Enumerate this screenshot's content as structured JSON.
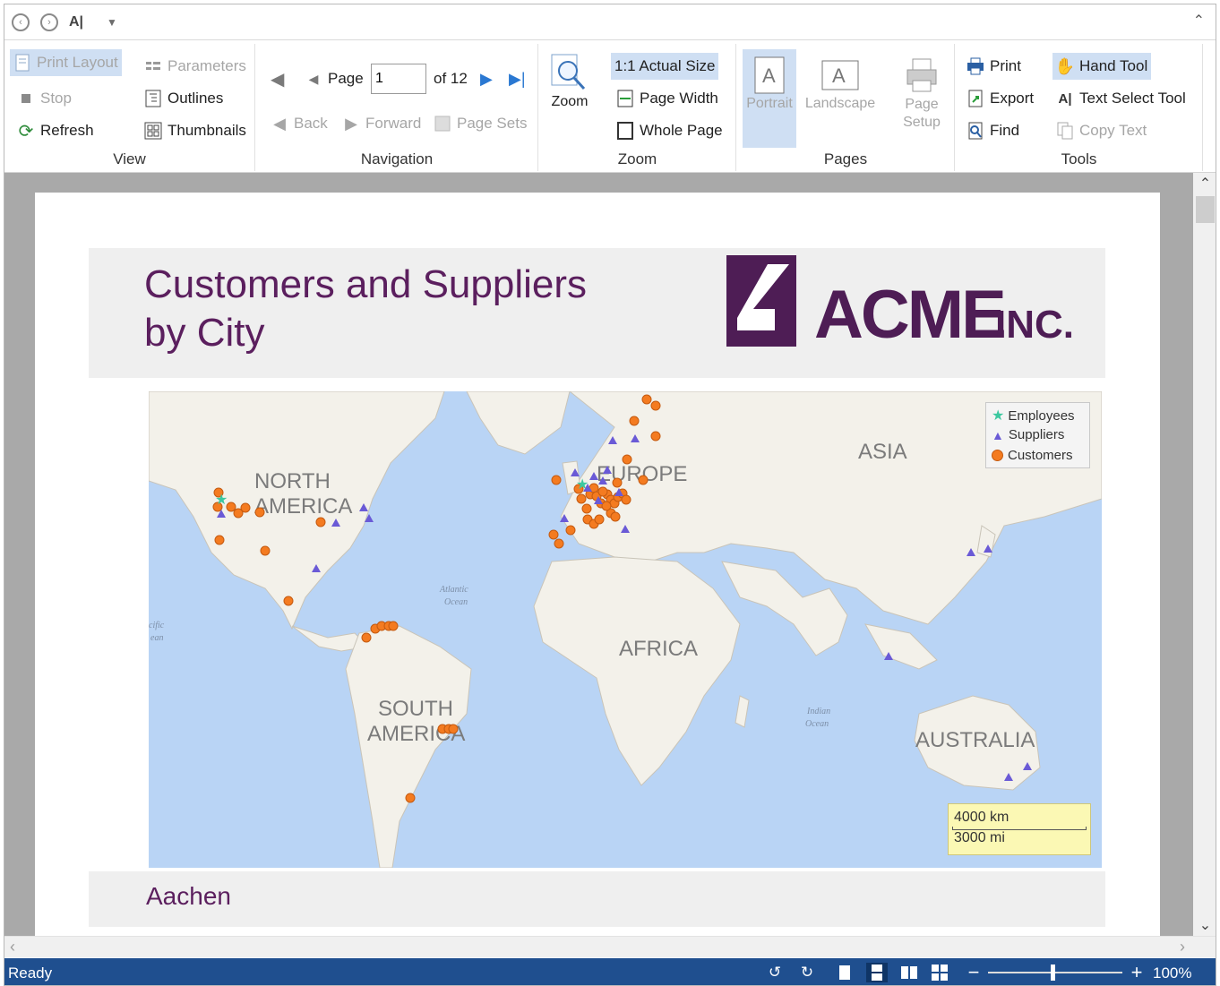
{
  "qat": {
    "icons": [
      "back-circle-icon",
      "forward-circle-icon",
      "text-select-icon",
      "customize-qat-icon"
    ]
  },
  "ribbon": {
    "view": {
      "label": "View",
      "print_layout": "Print Layout",
      "stop": "Stop",
      "refresh": "Refresh",
      "parameters": "Parameters",
      "outlines": "Outlines",
      "thumbnails": "Thumbnails"
    },
    "navigation": {
      "label": "Navigation",
      "page_label": "Page",
      "page_value": "1",
      "page_of": "of 12",
      "back": "Back",
      "forward": "Forward",
      "page_sets": "Page Sets"
    },
    "zoom": {
      "label": "Zoom",
      "zoom_button": "Zoom",
      "actual_size": "1:1 Actual Size",
      "page_width": "Page Width",
      "whole_page": "Whole Page"
    },
    "pages": {
      "label": "Pages",
      "portrait": "Portrait",
      "landscape": "Landscape",
      "page_setup_line1": "Page",
      "page_setup_line2": "Setup"
    },
    "tools": {
      "label": "Tools",
      "print": "Print",
      "export": "Export",
      "find": "Find",
      "hand_tool": "Hand Tool",
      "text_select_tool": "Text Select Tool",
      "copy_text": "Copy Text"
    }
  },
  "report": {
    "title_line1": "Customers and Suppliers",
    "title_line2": "by City",
    "logo_text": "ACME",
    "logo_suffix": "INC.",
    "city": "Aachen"
  },
  "map": {
    "labels": {
      "north_america_1": "NORTH",
      "north_america_2": "AMERICA",
      "south_america_1": "SOUTH",
      "south_america_2": "AMERICA",
      "europe": "EUROPE",
      "asia": "ASIA",
      "africa": "AFRICA",
      "australia": "AUSTRALIA",
      "atlantic_1": "Atlantic",
      "atlantic_2": "Ocean",
      "indian_1": "Indian",
      "indian_2": "Ocean",
      "pacific_1": "cific",
      "pacific_2": "ean"
    },
    "legend": {
      "employees": "Employees",
      "suppliers": "Suppliers",
      "customers": "Customers"
    },
    "scale": {
      "km": "4000 km",
      "mi": "3000 mi"
    },
    "colors": {
      "water": "#b9d4f5",
      "land": "#f3f1ea",
      "customer": "#f47b20",
      "supplier": "#6a5ad6",
      "employee": "#3cc8a0"
    }
  },
  "status": {
    "text": "Ready",
    "zoom": "100%",
    "icons": [
      "navigate-backward-icon",
      "navigate-forward-icon",
      "single-page-icon",
      "continuous-page-icon",
      "two-page-icon",
      "multi-page-icon",
      "zoom-out-icon",
      "zoom-in-icon"
    ]
  },
  "colors": {
    "accent": "#5b1f5e",
    "status_bar": "#1f4f8f",
    "selected": "#cfdff3"
  }
}
